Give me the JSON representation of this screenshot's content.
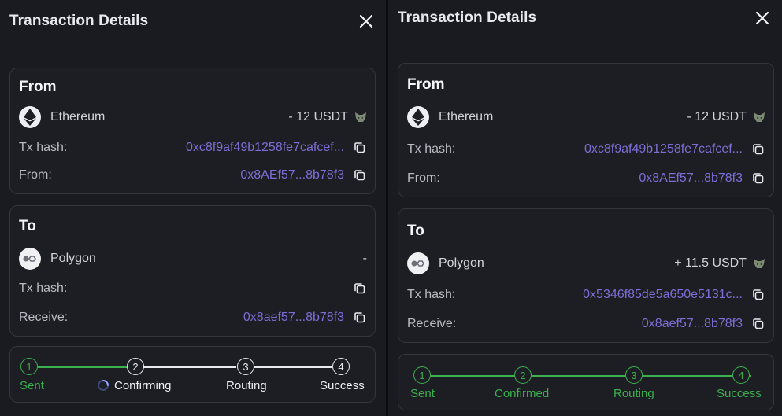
{
  "left": {
    "title": "Transaction Details",
    "from": {
      "heading": "From",
      "chain": "Ethereum",
      "amount": "- 12 USDT",
      "tx_hash_label": "Tx hash:",
      "tx_hash": "0xc8f9af49b1258fe7cafcef...",
      "from_label": "From:",
      "from_address": "0x8AEf57...8b78f3"
    },
    "to": {
      "heading": "To",
      "chain": "Polygon",
      "amount": "-",
      "tx_hash_label": "Tx hash:",
      "tx_hash": "",
      "receive_label": "Receive:",
      "receive_address": "0x8aef57...8b78f3"
    },
    "steps": [
      {
        "number": "1",
        "label": "Sent",
        "state": "done"
      },
      {
        "number": "2",
        "label": "Confirming",
        "state": "active"
      },
      {
        "number": "3",
        "label": "Routing",
        "state": "pending"
      },
      {
        "number": "4",
        "label": "Success",
        "state": "pending"
      }
    ]
  },
  "right": {
    "title": "Transaction Details",
    "from": {
      "heading": "From",
      "chain": "Ethereum",
      "amount": "- 12 USDT",
      "tx_hash_label": "Tx hash:",
      "tx_hash": "0xc8f9af49b1258fe7cafcef...",
      "from_label": "From:",
      "from_address": "0x8AEf57...8b78f3"
    },
    "to": {
      "heading": "To",
      "chain": "Polygon",
      "amount": "+ 11.5 USDT",
      "tx_hash_label": "Tx hash:",
      "tx_hash": "0x5346f85de5a650e5131c...",
      "receive_label": "Receive:",
      "receive_address": "0x8aef57...8b78f3"
    },
    "steps": [
      {
        "number": "1",
        "label": "Sent",
        "state": "done"
      },
      {
        "number": "2",
        "label": "Confirmed",
        "state": "done"
      },
      {
        "number": "3",
        "label": "Routing",
        "state": "done"
      },
      {
        "number": "4",
        "label": "Success",
        "state": "done"
      }
    ]
  },
  "colors": {
    "link": "#7a6fd6",
    "success_green": "#3bb04f",
    "panel_bg": "#1a1b20",
    "card_border": "#34363d"
  },
  "icons": {
    "close": "close-icon",
    "copy": "copy-icon",
    "ethereum": "ethereum-icon",
    "polygon": "polygon-icon",
    "wallet": "metamask-fox-icon",
    "spinner": "loading-spinner-icon"
  }
}
